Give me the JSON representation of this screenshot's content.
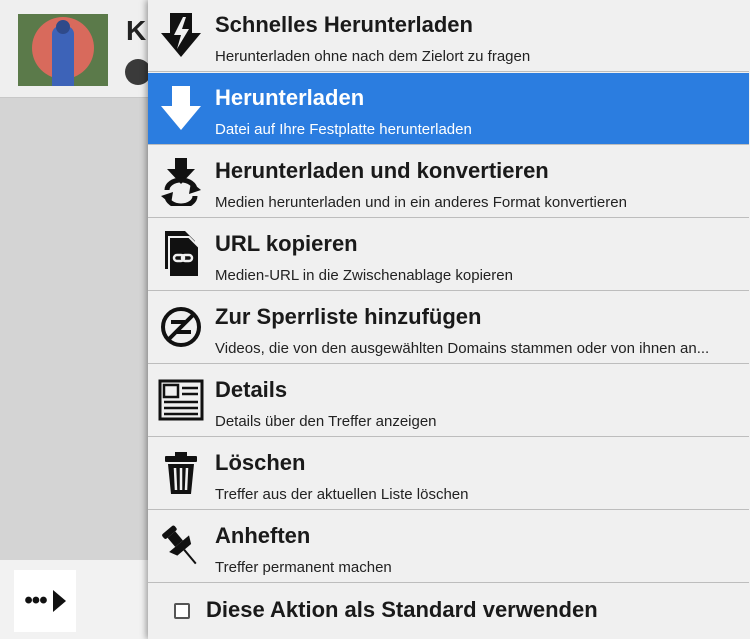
{
  "background": {
    "partial_title": "K"
  },
  "menu": {
    "items": [
      {
        "icon": "fast-download-icon",
        "title": "Schnelles Herunterladen",
        "desc": "Herunterladen ohne nach dem Zielort zu fragen"
      },
      {
        "icon": "download-icon",
        "title": "Herunterladen",
        "desc": "Datei auf Ihre Festplatte herunterladen",
        "active": true
      },
      {
        "icon": "download-convert-icon",
        "title": "Herunterladen und konvertieren",
        "desc": "Medien herunterladen und in ein anderes Format konvertieren"
      },
      {
        "icon": "copy-url-icon",
        "title": "URL kopieren",
        "desc": "Medien-URL in die Zwischenablage kopieren"
      },
      {
        "icon": "blacklist-icon",
        "title": "Zur Sperrliste hinzufügen",
        "desc": "Videos, die von den ausgewählten Domains stammen oder von ihnen an..."
      },
      {
        "icon": "details-icon",
        "title": "Details",
        "desc": "Details über den Treffer anzeigen"
      },
      {
        "icon": "trash-icon",
        "title": "Löschen",
        "desc": "Treffer aus der aktuellen Liste löschen"
      },
      {
        "icon": "pin-icon",
        "title": "Anheften",
        "desc": "Treffer permanent machen"
      }
    ],
    "default_action_label": "Diese Aktion als Standard verwenden",
    "default_action_checked": false
  },
  "colors": {
    "active_bg": "#2b7de0",
    "menu_bg": "#f0f0f0"
  }
}
